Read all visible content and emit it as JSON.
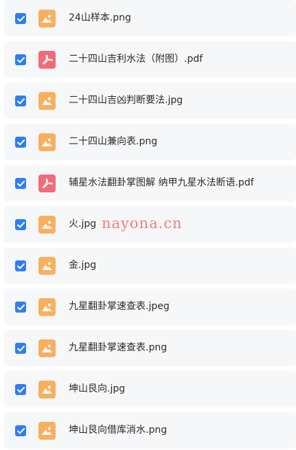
{
  "files": [
    {
      "name": "24山样本.png",
      "type": "image",
      "checked": true
    },
    {
      "name": "二十四山吉利水法（附图）.pdf",
      "type": "pdf",
      "checked": true
    },
    {
      "name": "二十四山吉凶判断要法.jpg",
      "type": "image",
      "checked": true
    },
    {
      "name": "二十四山兼向表.png",
      "type": "image",
      "checked": true
    },
    {
      "name": "辅星水法翻卦掌图解 纳甲九星水法断语.pdf",
      "type": "pdf",
      "checked": true
    },
    {
      "name": "火.jpg",
      "type": "image",
      "checked": true
    },
    {
      "name": "金.jpg",
      "type": "image",
      "checked": true
    },
    {
      "name": "九星翻卦掌速查表.jpeg",
      "type": "image",
      "checked": true
    },
    {
      "name": "九星翻卦掌速查表.png",
      "type": "image",
      "checked": true
    },
    {
      "name": "坤山艮向.jpg",
      "type": "image",
      "checked": true
    },
    {
      "name": "坤山艮向借库消水.png",
      "type": "image",
      "checked": true
    }
  ],
  "watermark": "nayona.cn",
  "colors": {
    "checkbox": "#2f7df6",
    "image_icon": "#f8b05f",
    "pdf_icon": "#f26b7a",
    "row_background": "#f6f7f9",
    "watermark": "#f07d7d"
  },
  "icons": {
    "checkbox": "checkbox-checked-icon",
    "image": "image-file-icon",
    "pdf": "pdf-file-icon"
  }
}
